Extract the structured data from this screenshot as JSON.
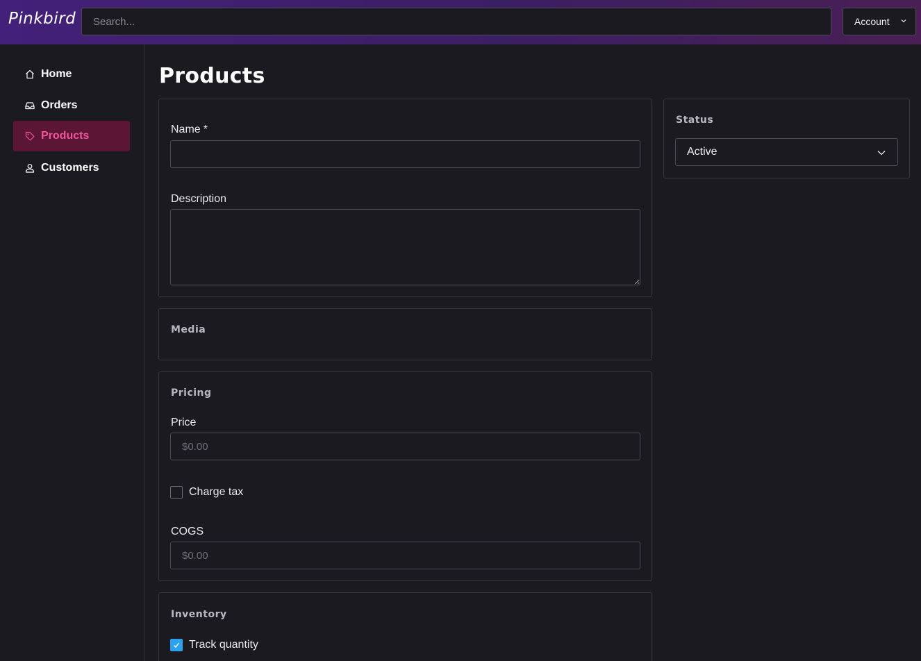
{
  "header": {
    "brand": "Pinkbird",
    "search_placeholder": "Search...",
    "account_label": "Account"
  },
  "sidebar": {
    "items": [
      {
        "label": "Home",
        "icon": "home-icon"
      },
      {
        "label": "Orders",
        "icon": "inbox-icon"
      },
      {
        "label": "Products",
        "icon": "tag-icon",
        "active": true
      },
      {
        "label": "Customers",
        "icon": "user-icon"
      }
    ]
  },
  "main": {
    "page_title": "Products",
    "details": {
      "name_label": "Name",
      "required_mark": "*",
      "name_value": "",
      "description_label": "Description",
      "description_value": ""
    },
    "media": {
      "title": "Media"
    },
    "pricing": {
      "title": "Pricing",
      "price_label": "Price",
      "price_placeholder": "$0.00",
      "charge_tax_label": "Charge tax",
      "charge_tax_checked": false,
      "cogs_label": "COGS",
      "cogs_placeholder": "$0.00"
    },
    "inventory": {
      "title": "Inventory",
      "track_quantity_label": "Track quantity",
      "track_quantity_checked": true
    },
    "status": {
      "title": "Status",
      "selected": "Active"
    }
  },
  "colors": {
    "background": "#1b1a20",
    "accent_pink": "#f0559a",
    "active_nav_bg": "#5a1634",
    "checkbox_blue": "#2aa2f0",
    "header_gradient_start": "#43207a",
    "header_gradient_end": "#4a1f55"
  }
}
